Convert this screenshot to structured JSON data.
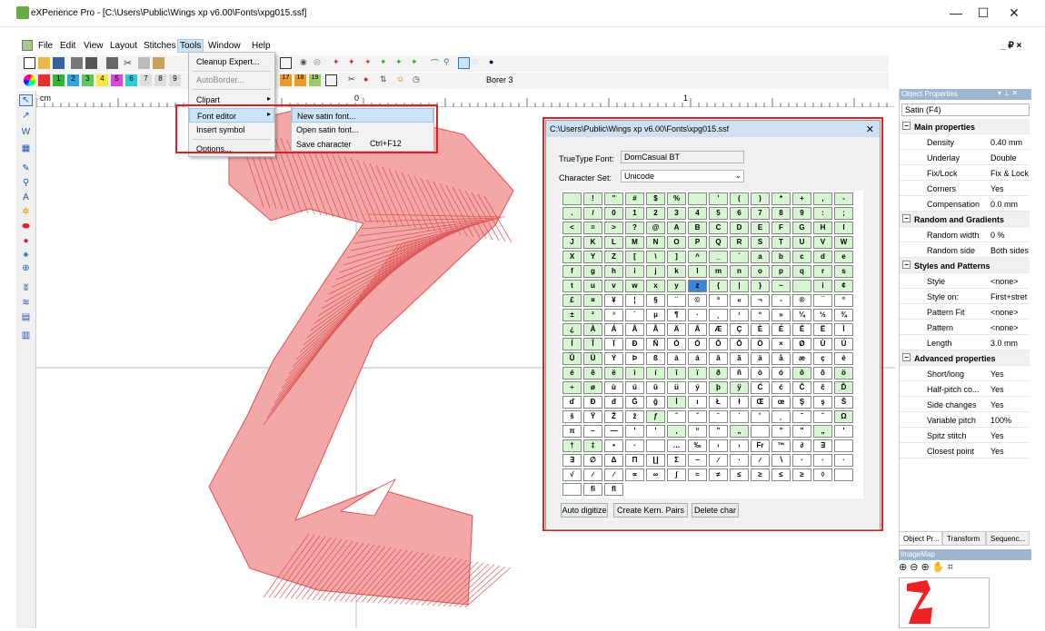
{
  "window": {
    "title": "eXPerience Pro - [C:\\Users\\Public\\Wings xp v6.00\\Fonts\\xpg015.ssf]",
    "minimize": "—",
    "maximize": "☐",
    "close": "✕",
    "mdi_controls": "_ ₽ ×"
  },
  "menubar": {
    "items": [
      "File",
      "Edit",
      "View",
      "Layout",
      "Stitches",
      "Tools",
      "Window",
      "Help"
    ]
  },
  "toolbar": {
    "color_numbers": [
      "1",
      "2",
      "3",
      "4",
      "5",
      "6",
      "7",
      "8",
      "9"
    ],
    "stitch_numbers": [
      "17",
      "18",
      "19"
    ],
    "borer_label": "Borer 3"
  },
  "ruler": {
    "unit": "cm",
    "zero": "0",
    "one": "1"
  },
  "tools_menu": {
    "items": [
      "Cleanup Expert...",
      "AutoBorder...",
      "Clipart",
      "Font editor",
      "Insert symbol",
      "Options..."
    ]
  },
  "font_submenu": {
    "items": [
      "New satin font...",
      "Open satin font...",
      "Save character"
    ],
    "shortcut": "Ctrl+F12"
  },
  "dialog": {
    "title": "C:\\Users\\Public\\Wings xp v6.00\\Fonts\\xpg015.ssf",
    "truetype_label": "TrueType Font:",
    "truetype_value": "DomCasual BT",
    "charset_label": "Character Set:",
    "charset_value": "Unicode",
    "buttons": [
      "Auto digitize",
      "Create Kern. Pairs",
      "Delete char"
    ],
    "grid_rows": [
      [
        "",
        "!",
        "\"",
        "#",
        "$",
        "%",
        "",
        "'",
        "(",
        ")",
        "*",
        "+",
        ",",
        "-"
      ],
      [
        ".",
        "/",
        "0",
        "1",
        "2",
        "3",
        "4",
        "5",
        "6",
        "7",
        "8",
        "9",
        ":",
        ";"
      ],
      [
        "<",
        "=",
        ">",
        "?",
        "@",
        "A",
        "B",
        "C",
        "D",
        "E",
        "F",
        "G",
        "H",
        "I"
      ],
      [
        "J",
        "K",
        "L",
        "M",
        "N",
        "O",
        "P",
        "Q",
        "R",
        "S",
        "T",
        "U",
        "V",
        "W"
      ],
      [
        "X",
        "Y",
        "Z",
        "[",
        "\\",
        "]",
        "^",
        "_",
        "`",
        "a",
        "b",
        "c",
        "d",
        "e"
      ],
      [
        "f",
        "g",
        "h",
        "i",
        "j",
        "k",
        "l",
        "m",
        "n",
        "o",
        "p",
        "q",
        "r",
        "s"
      ],
      [
        "t",
        "u",
        "v",
        "w",
        "x",
        "y",
        "z",
        "{",
        "|",
        "}",
        "~",
        "",
        "i",
        "¢"
      ],
      [
        "£",
        "¤",
        "¥",
        "¦",
        "§",
        "¨",
        "©",
        "ª",
        "«",
        "¬",
        "-",
        "®",
        "¯",
        "°"
      ],
      [
        "±",
        "²",
        "³",
        "´",
        "µ",
        "¶",
        "·",
        "¸",
        "¹",
        "º",
        "»",
        "¼",
        "½",
        "¾"
      ],
      [
        "¿",
        "À",
        "Á",
        "Â",
        "Ã",
        "Ä",
        "Å",
        "Æ",
        "Ç",
        "È",
        "É",
        "Ê",
        "Ë",
        "Ì"
      ],
      [
        "Í",
        "Î",
        "Ï",
        "Ð",
        "Ñ",
        "Ò",
        "Ó",
        "Ô",
        "Õ",
        "Ö",
        "×",
        "Ø",
        "Ù",
        "Ú"
      ],
      [
        "Û",
        "Ü",
        "Ý",
        "Þ",
        "ß",
        "à",
        "á",
        "â",
        "ã",
        "ä",
        "å",
        "æ",
        "ç",
        "è"
      ],
      [
        "é",
        "ê",
        "ë",
        "ì",
        "í",
        "î",
        "ï",
        "ð",
        "ñ",
        "ò",
        "ó",
        "ô",
        "õ",
        "ö"
      ],
      [
        "÷",
        "ø",
        "ù",
        "ú",
        "û",
        "ü",
        "ý",
        "þ",
        "ÿ",
        "Ć",
        "ć",
        "Č",
        "č",
        "Ď"
      ],
      [
        "ď",
        "Đ",
        "đ",
        "Ğ",
        "ğ",
        "İ",
        "ı",
        "Ł",
        "ł",
        "Œ",
        "œ",
        "Ş",
        "ş",
        "Š"
      ],
      [
        "š",
        "Ÿ",
        "Ž",
        "ž",
        "ƒ",
        "ˆ",
        "ˇ",
        "˘",
        "˙",
        "˚",
        "˛",
        "˜",
        "˝",
        "Ω"
      ],
      [
        "π",
        "–",
        "—",
        "'",
        "'",
        "‚",
        "“",
        "”",
        "„",
        "",
        "\"",
        "\"",
        "„",
        "'"
      ],
      [
        "†",
        "‡",
        "•",
        "·",
        "",
        "…",
        "‰",
        "‹",
        "›",
        "Fr",
        "™",
        "∂",
        "∃",
        ""
      ],
      [
        "∃",
        "∅",
        "Δ",
        "Π",
        "∐",
        "Σ",
        "−",
        "∕",
        "∙",
        "∕",
        "∖",
        "·",
        "·",
        "·"
      ],
      [
        "√",
        "∕",
        "∕",
        "∝",
        "∞",
        "∫",
        "≈",
        "≠",
        "≤",
        "≥",
        "≤",
        "≥",
        "◊",
        ""
      ],
      [
        "",
        "fi",
        "fl"
      ]
    ],
    "green_rows": [
      0,
      1,
      2,
      3,
      4,
      5,
      6
    ],
    "selected": "z"
  },
  "props": {
    "header": "Object Properties",
    "combo": "Satin (F4)",
    "rows": [
      {
        "k": "Main properties",
        "v": "",
        "sec": true
      },
      {
        "k": "Density",
        "v": "0.40 mm"
      },
      {
        "k": "Underlay",
        "v": "Double"
      },
      {
        "k": "Fix/Lock",
        "v": "Fix & Lock"
      },
      {
        "k": "Corners",
        "v": "Yes"
      },
      {
        "k": "Compensation",
        "v": "0.0 mm"
      },
      {
        "k": "Random and Gradients",
        "v": "",
        "sec": true
      },
      {
        "k": "Random width",
        "v": "0 %"
      },
      {
        "k": "Random side",
        "v": "Both sides"
      },
      {
        "k": "Styles and Patterns",
        "v": "",
        "sec": true
      },
      {
        "k": "Style",
        "v": "<none>"
      },
      {
        "k": "Style on:",
        "v": "First+stret"
      },
      {
        "k": "Pattern Fit",
        "v": "<none>"
      },
      {
        "k": "Pattern",
        "v": "<none>"
      },
      {
        "k": "Length",
        "v": "3.0 mm"
      },
      {
        "k": "Advanced properties",
        "v": "",
        "sec": true
      },
      {
        "k": "Short/long",
        "v": "Yes"
      },
      {
        "k": "Half-pitch co...",
        "v": "Yes"
      },
      {
        "k": "Side changes",
        "v": "Yes"
      },
      {
        "k": "Variable pitch",
        "v": "100%"
      },
      {
        "k": "Spitz stitch",
        "v": "Yes"
      },
      {
        "k": "Closest point",
        "v": "Yes"
      }
    ],
    "tabs": [
      "Object Pr...",
      "Transform",
      "Sequenc..."
    ],
    "imagemap": "ImageMap"
  },
  "colors": {
    "accent_red": "#e31e24",
    "stitch_fill": "#f4a7a7",
    "grid_green": "#d7f5d3"
  }
}
